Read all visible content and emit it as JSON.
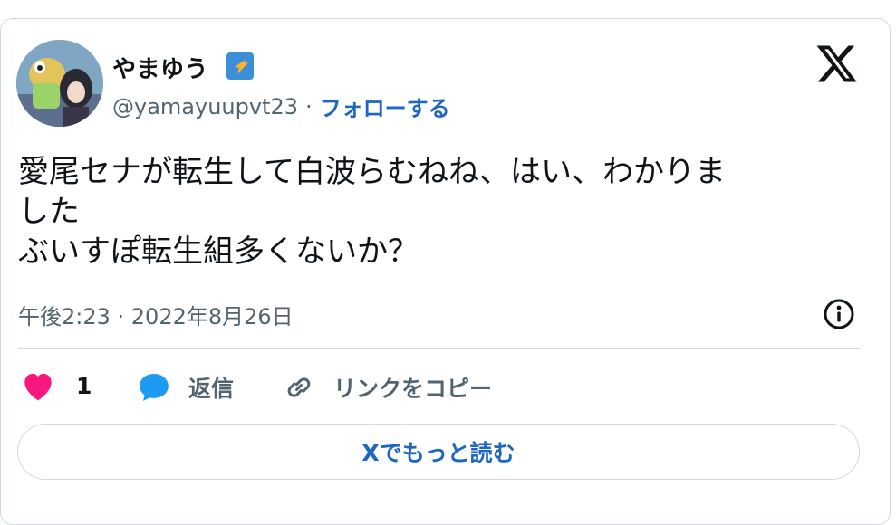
{
  "user": {
    "display_name": "やまゆう",
    "handle": "@yamayuupvt23",
    "separator": "·",
    "follow_label": "フォローする"
  },
  "tweet": {
    "text": "愛尾セナが転生して白波らむねね、はい、わかりま\nした\nぶいすぽ転生組多くないか？",
    "timestamp": "午後2:23 · 2022年8月26日"
  },
  "actions": {
    "like_count": "1",
    "reply_label": "返信",
    "copy_link_label": "リンクをコピー"
  },
  "read_more_label": "Xでもっと読む",
  "colors": {
    "accent": "#1d66c2",
    "heart": "#f91880",
    "reply_bubble": "#1d9bf0",
    "muted_text": "#536471",
    "border": "#cfd9de"
  },
  "icons": [
    "x-logo-icon",
    "verified-badge-icon",
    "info-icon",
    "heart-icon",
    "reply-bubble-icon",
    "link-icon"
  ]
}
